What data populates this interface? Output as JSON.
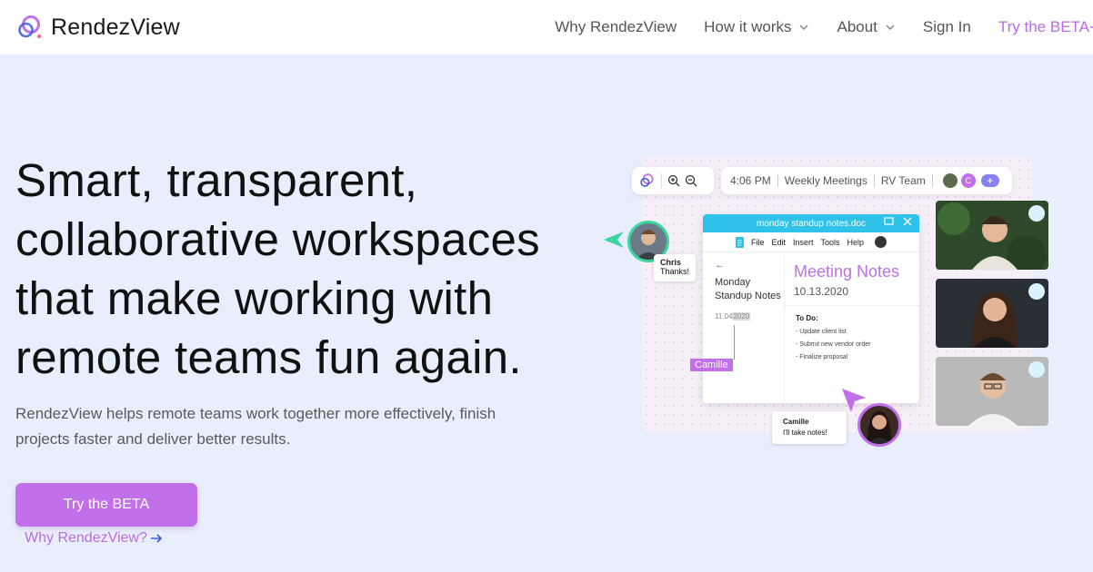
{
  "brand": {
    "name": "RendezView"
  },
  "nav": {
    "items": [
      {
        "label": "Why RendezView",
        "dropdown": false
      },
      {
        "label": "How it works",
        "dropdown": true
      },
      {
        "label": "About",
        "dropdown": true
      },
      {
        "label": "Sign In",
        "dropdown": false
      }
    ],
    "beta_label": "Try the BETA"
  },
  "hero": {
    "title": "Smart, transparent, collaborative workspaces that make working with remote teams fun again.",
    "subtitle": "RendezView helps remote teams work together more effectively, finish projects faster and deliver better results.",
    "cta_label": "Try the BETA",
    "link_label": "Why RendezView?"
  },
  "illustration": {
    "info_bar": {
      "time": "4:06 PM",
      "meeting": "Weekly Meetings",
      "team": "RV Team",
      "avatar_badge": "C",
      "add": "+"
    },
    "doc": {
      "filename": "monday standup notes.doc",
      "menu": [
        "File",
        "Edit",
        "Insert",
        "Tools",
        "Help"
      ],
      "side_back": "←",
      "side_title": "Monday Standup Notes",
      "side_date_prefix": "11.04",
      "side_date_highlight": "2020",
      "heading": "Meeting Notes",
      "date": "10.13.2020",
      "todo_title": "To Do:",
      "todo_items": [
        "- Update client list",
        "- Submit new vendor order",
        "- Finalize proposal"
      ]
    },
    "cursor_label": "Camille",
    "chris": {
      "name": "Chris",
      "message": "Thanks!"
    },
    "camille": {
      "name": "Camille",
      "message": "I'll take notes!"
    }
  },
  "colors": {
    "accent": "#c270ea",
    "background": "#e9eefc",
    "doc_header": "#2fc2e8",
    "green": "#3dd6a0"
  }
}
